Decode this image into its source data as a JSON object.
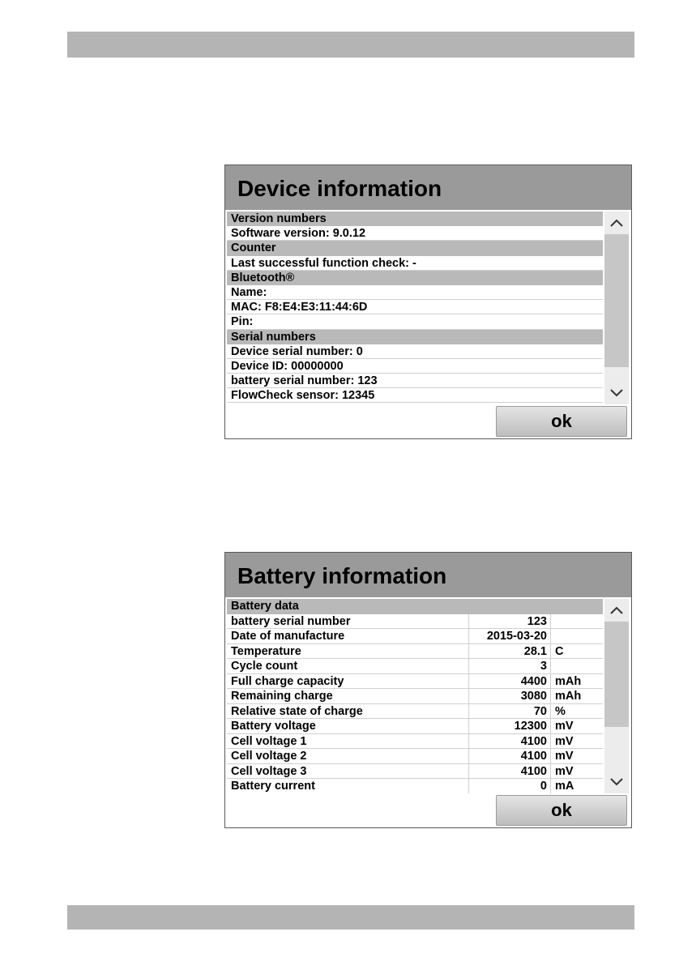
{
  "device_dialog": {
    "title": "Device information",
    "rows": [
      {
        "text": "Version numbers",
        "section": true
      },
      {
        "text": "Software version: 9.0.12",
        "section": false
      },
      {
        "text": "Counter",
        "section": true
      },
      {
        "text": "Last successful function check: -",
        "section": false
      },
      {
        "text": "Bluetooth®",
        "section": true
      },
      {
        "text": "Name:",
        "section": false
      },
      {
        "text": "MAC: F8:E4:E3:11:44:6D",
        "section": false
      },
      {
        "text": "Pin:",
        "section": false
      },
      {
        "text": "Serial numbers",
        "section": true
      },
      {
        "text": "Device serial number: 0",
        "section": false
      },
      {
        "text": "Device ID: 00000000",
        "section": false
      },
      {
        "text": "battery serial number: 123",
        "section": false
      },
      {
        "text": "FlowCheck sensor: 12345",
        "section": false
      }
    ],
    "ok_label": "ok",
    "scroll_up_icon": "chevron-up-icon",
    "scroll_down_icon": "chevron-down-icon"
  },
  "battery_dialog": {
    "title": "Battery information",
    "section_label": "Battery data",
    "rows": [
      {
        "label": "battery serial number",
        "value": "123",
        "unit": ""
      },
      {
        "label": "Date of manufacture",
        "value": "2015-03-20",
        "unit": ""
      },
      {
        "label": "Temperature",
        "value": "28.1",
        "unit": "C"
      },
      {
        "label": "Cycle count",
        "value": "3",
        "unit": ""
      },
      {
        "label": "Full charge capacity",
        "value": "4400",
        "unit": "mAh"
      },
      {
        "label": "Remaining charge",
        "value": "3080",
        "unit": "mAh"
      },
      {
        "label": "Relative state of charge",
        "value": "70",
        "unit": "%"
      },
      {
        "label": "Battery voltage",
        "value": "12300",
        "unit": "mV"
      },
      {
        "label": "Cell voltage 1",
        "value": "4100",
        "unit": "mV"
      },
      {
        "label": "Cell voltage 2",
        "value": "4100",
        "unit": "mV"
      },
      {
        "label": "Cell voltage 3",
        "value": "4100",
        "unit": "mV"
      },
      {
        "label": "Battery current",
        "value": "0",
        "unit": "mA"
      }
    ],
    "ok_label": "ok",
    "scroll_up_icon": "chevron-up-icon",
    "scroll_down_icon": "chevron-down-icon"
  }
}
